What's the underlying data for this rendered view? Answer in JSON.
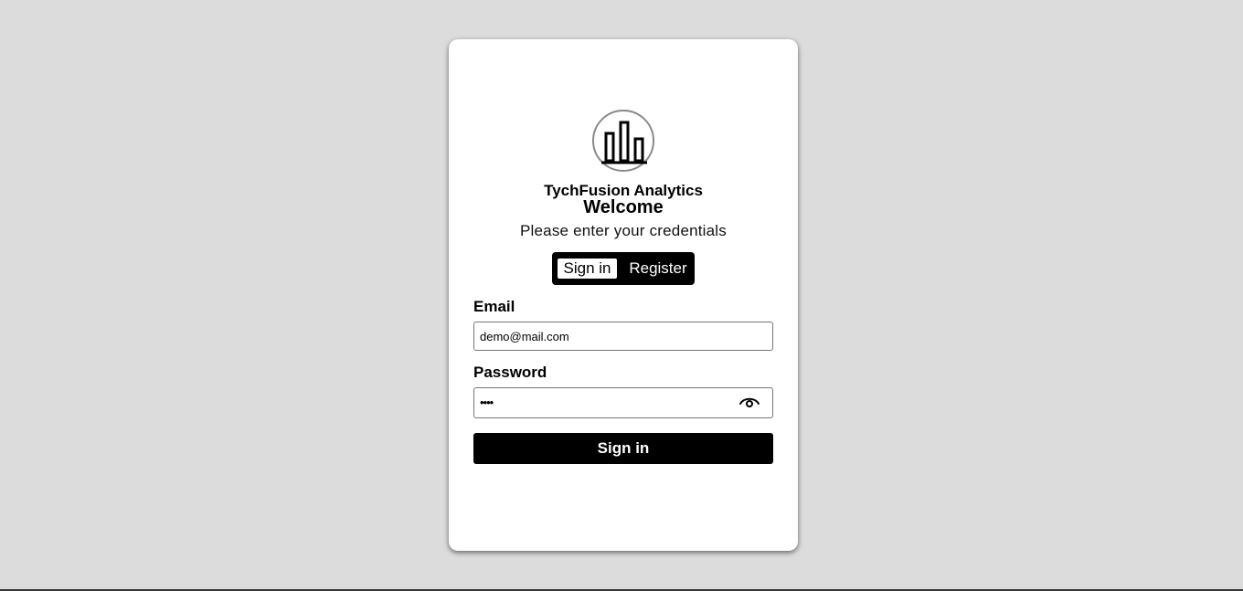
{
  "brand": {
    "name": "TychFusion Analytics",
    "logo_icon": "bar-chart-icon"
  },
  "heading": {
    "title": "Welcome",
    "subtitle": "Please enter your credentials"
  },
  "tabs": {
    "signin_label": "Sign in",
    "register_label": "Register",
    "active": "Sign in"
  },
  "form": {
    "email_label": "Email",
    "email_value": "demo@mail.com",
    "password_label": "Password",
    "password_masked": "••••",
    "password_toggle_icon": "eye-icon",
    "submit_label": "Sign in"
  },
  "colors": {
    "background": "#dddcdd",
    "card": "#ffffff",
    "primary": "#000000"
  }
}
